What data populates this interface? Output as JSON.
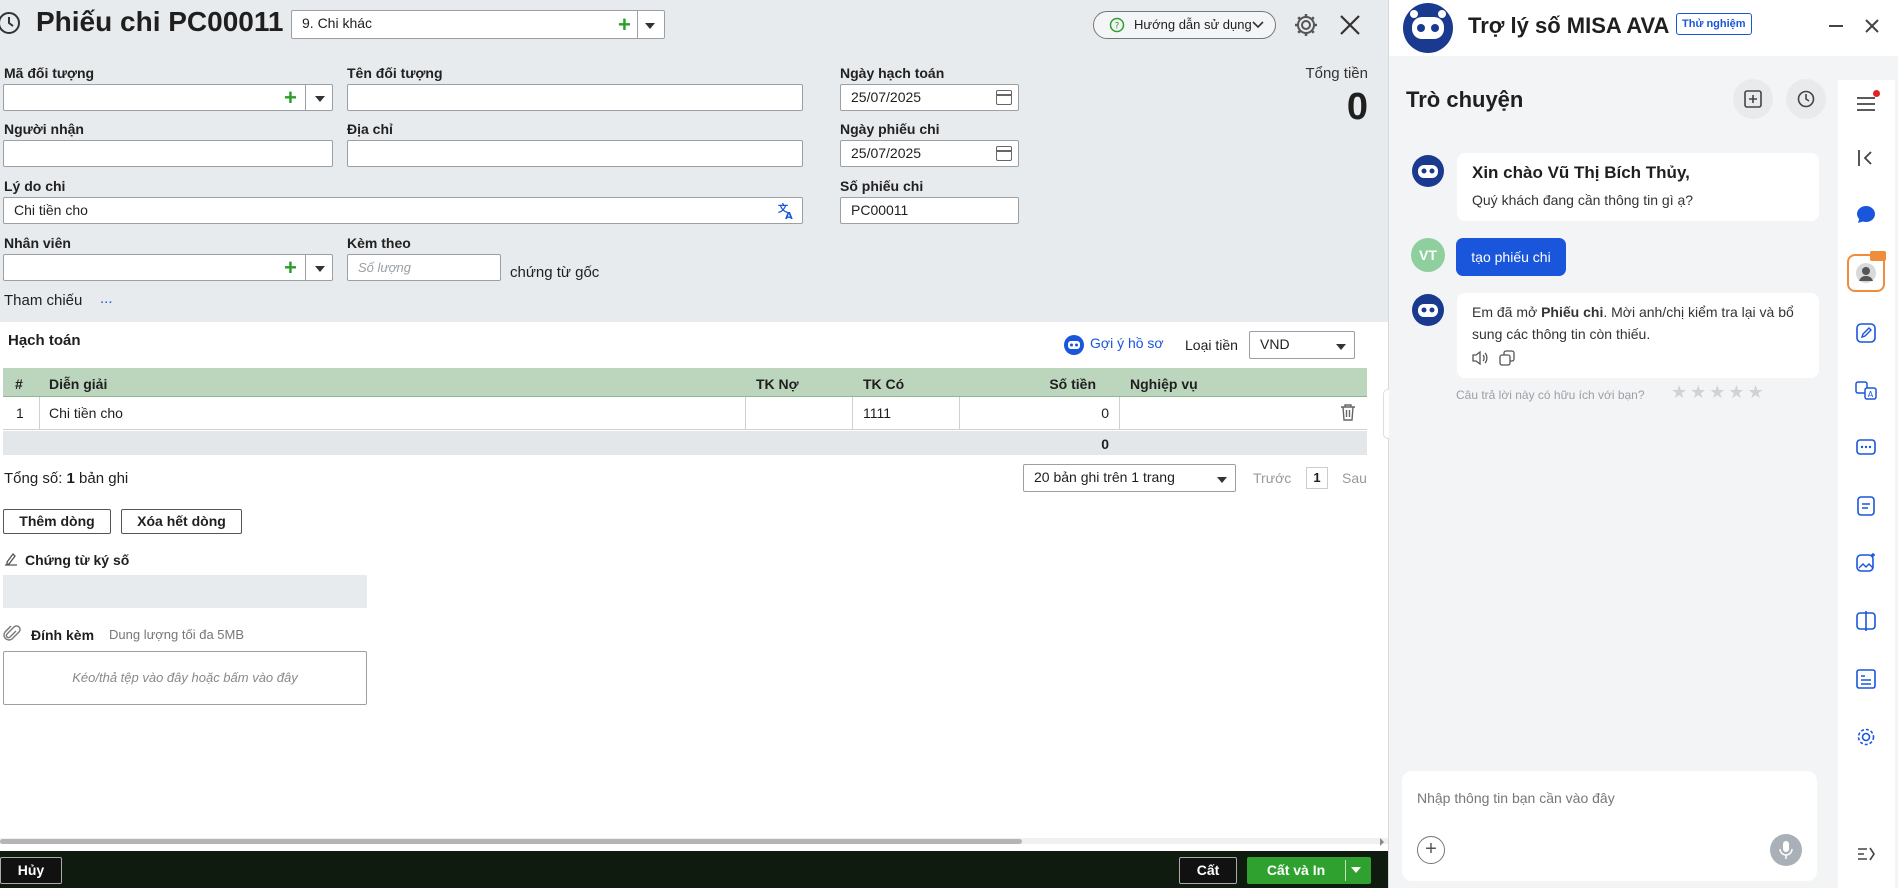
{
  "header": {
    "title": "Phiếu chi PC00011",
    "type_value": "9. Chi khác",
    "help_label": "Hướng dẫn sử dụng"
  },
  "form": {
    "ma_doi_tuong_label": "Mã đối tượng",
    "ten_doi_tuong_label": "Tên đối tượng",
    "nguoi_nhan_label": "Người nhận",
    "dia_chi_label": "Địa chỉ",
    "ly_do_chi_label": "Lý do chi",
    "ly_do_chi_value": "Chi tiền cho",
    "nhan_vien_label": "Nhân viên",
    "kem_theo_label": "Kèm theo",
    "kem_theo_placeholder": "Số lượng",
    "chung_tu_goc": "chứng từ gốc",
    "tham_chieu_label": "Tham chiếu",
    "tham_chieu_more": "...",
    "ngay_hach_toan_label": "Ngày hạch toán",
    "ngay_hach_toan_value": "25/07/2025",
    "ngay_phieu_chi_label": "Ngày phiếu chi",
    "ngay_phieu_chi_value": "25/07/2025",
    "so_phieu_chi_label": "Số phiếu chi",
    "so_phieu_chi_value": "PC00011",
    "tong_tien_label": "Tổng tiền",
    "tong_tien_value": "0"
  },
  "hach_toan": {
    "title": "Hạch toán",
    "goi_y": "Gợi ý hồ sơ",
    "loai_tien_label": "Loại tiền",
    "loai_tien_value": "VND",
    "columns": [
      "#",
      "Diễn giải",
      "TK Nợ",
      "TK Có",
      "Số tiền",
      "Nghiệp vụ"
    ],
    "rows": [
      {
        "no": "1",
        "dien_giai": "Chi tiền cho",
        "tk_no": "",
        "tk_co": "1111",
        "so_tien": "0",
        "nghiep_vu": ""
      }
    ],
    "total": "0",
    "tong_so_prefix": "Tổng số: ",
    "tong_so_count": "1",
    "tong_so_suffix": " bản ghi",
    "page_size": "20 bản ghi trên 1 trang",
    "prev": "Trước",
    "page": "1",
    "next": "Sau",
    "add_row": "Thêm dòng",
    "clear_rows": "Xóa hết dòng"
  },
  "chung_tu_ky_so": "Chứng từ ký số",
  "dinh_kem": {
    "label": "Đính kèm",
    "limit": "Dung lượng tối đa 5MB",
    "drop": "Kéo/thả tệp vào đây hoặc bấm vào đây"
  },
  "footer": {
    "cancel": "Hủy",
    "save": "Cất",
    "save_print": "Cất và In"
  },
  "assistant": {
    "title": "Trợ lý số MISA AVA",
    "badge": "Thử nghiệm",
    "chat_title": "Trò chuyện",
    "bot_greeting_title": "Xin chào Vũ Thị Bích Thủy,",
    "bot_greeting_sub": "Quý khách đang cần thông tin gì ạ?",
    "user_initials": "VT",
    "user_msg": "tạo phiếu chi",
    "bot_reply_pre": "Em đã mở ",
    "bot_reply_bold": "Phiếu chi",
    "bot_reply_post": ". Mời anh/chị kiểm tra lại và bổ sung các thông tin còn thiếu.",
    "feedback": "Câu trả lời này có hữu ích với bạn?",
    "input_placeholder": "Nhập thông tin bạn cần vào đây"
  },
  "colors": {
    "accent_green": "#2ea12e",
    "table_header": "#bcd6bd",
    "chat_blue": "#1a56db",
    "footer_bg": "#0f1b0f"
  }
}
